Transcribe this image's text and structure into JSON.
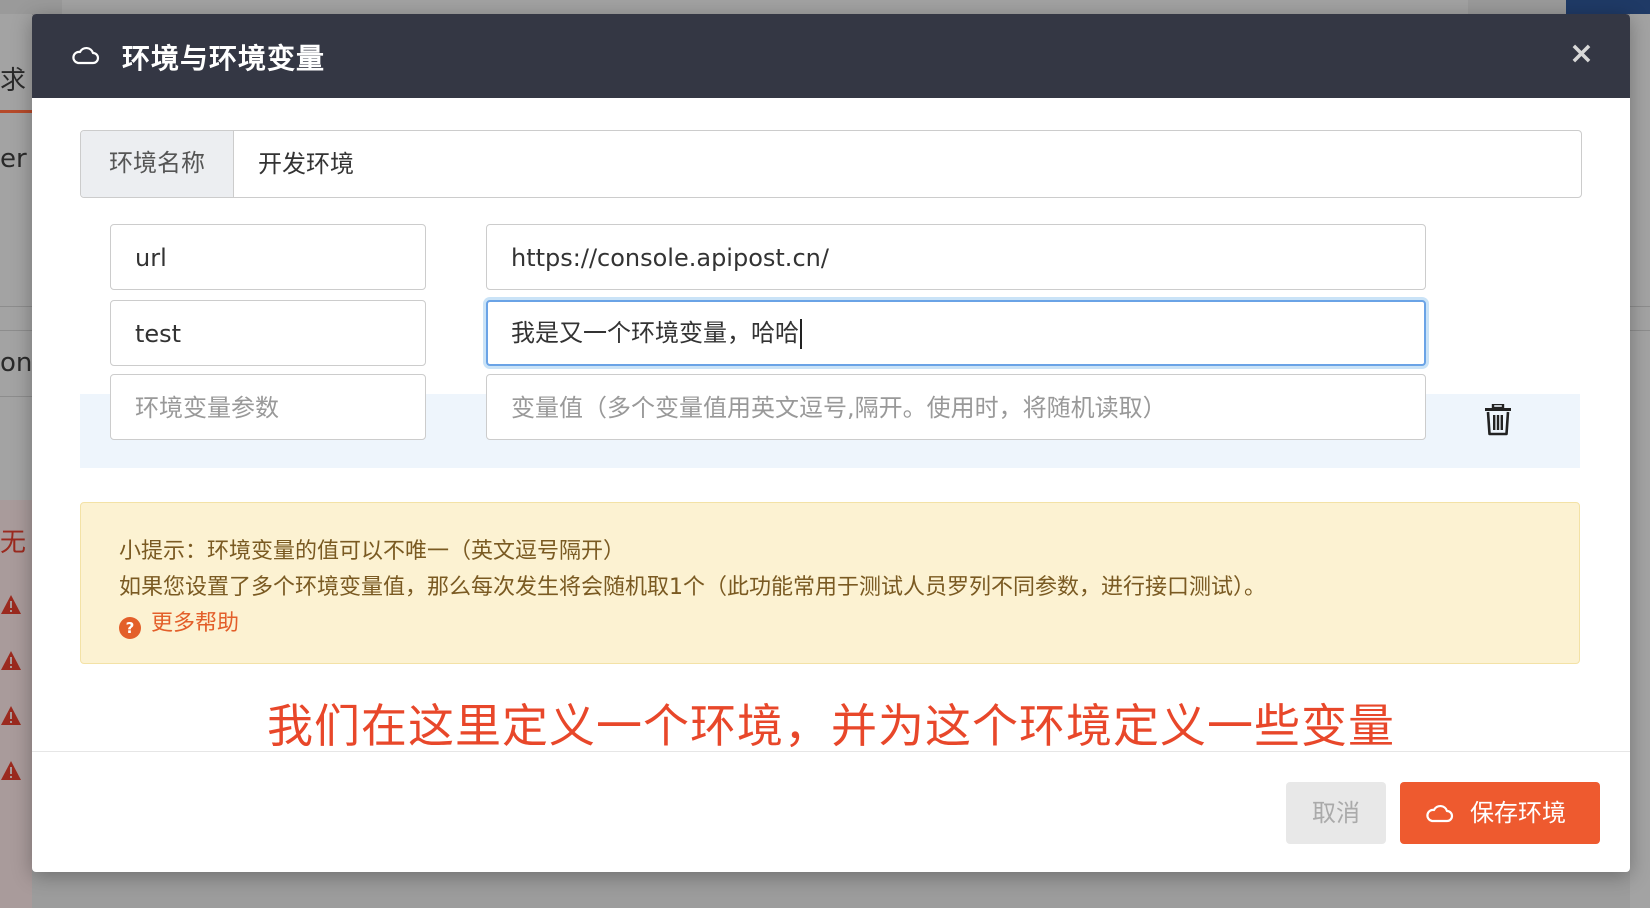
{
  "background": {
    "partial_texts": [
      "求",
      "er",
      "on",
      "无"
    ],
    "active_tab_color": "#b64a2a"
  },
  "modal": {
    "title": "环境与环境变量",
    "close_symbol": "×",
    "env_name_label": "环境名称",
    "env_name_value": "开发环境",
    "variables": [
      {
        "key": "url",
        "value": "https://console.apipost.cn/"
      },
      {
        "key": "test",
        "value": "我是又一个环境变量，哈哈"
      }
    ],
    "new_row": {
      "key_placeholder": "环境变量参数",
      "value_placeholder": "变量值（多个变量值用英文逗号,隔开。使用时，将随机读取）"
    },
    "tip": {
      "line1": "小提示：环境变量的值可以不唯一（英文逗号隔开）",
      "line2": "如果您设置了多个环境变量值，那么每次发生将会随机取1个（此功能常用于测试人员罗列不同参数，进行接口测试）。",
      "help_link": "更多帮助"
    },
    "annotation": "我们在这里定义一个环境，并为这个环境定义一些变量",
    "buttons": {
      "cancel": "取消",
      "save": "保存环境"
    }
  },
  "colors": {
    "header_bg": "#343744",
    "accent": "#ee5a2f",
    "tip_bg": "#fcf2d2",
    "annotation": "#e8472a"
  }
}
